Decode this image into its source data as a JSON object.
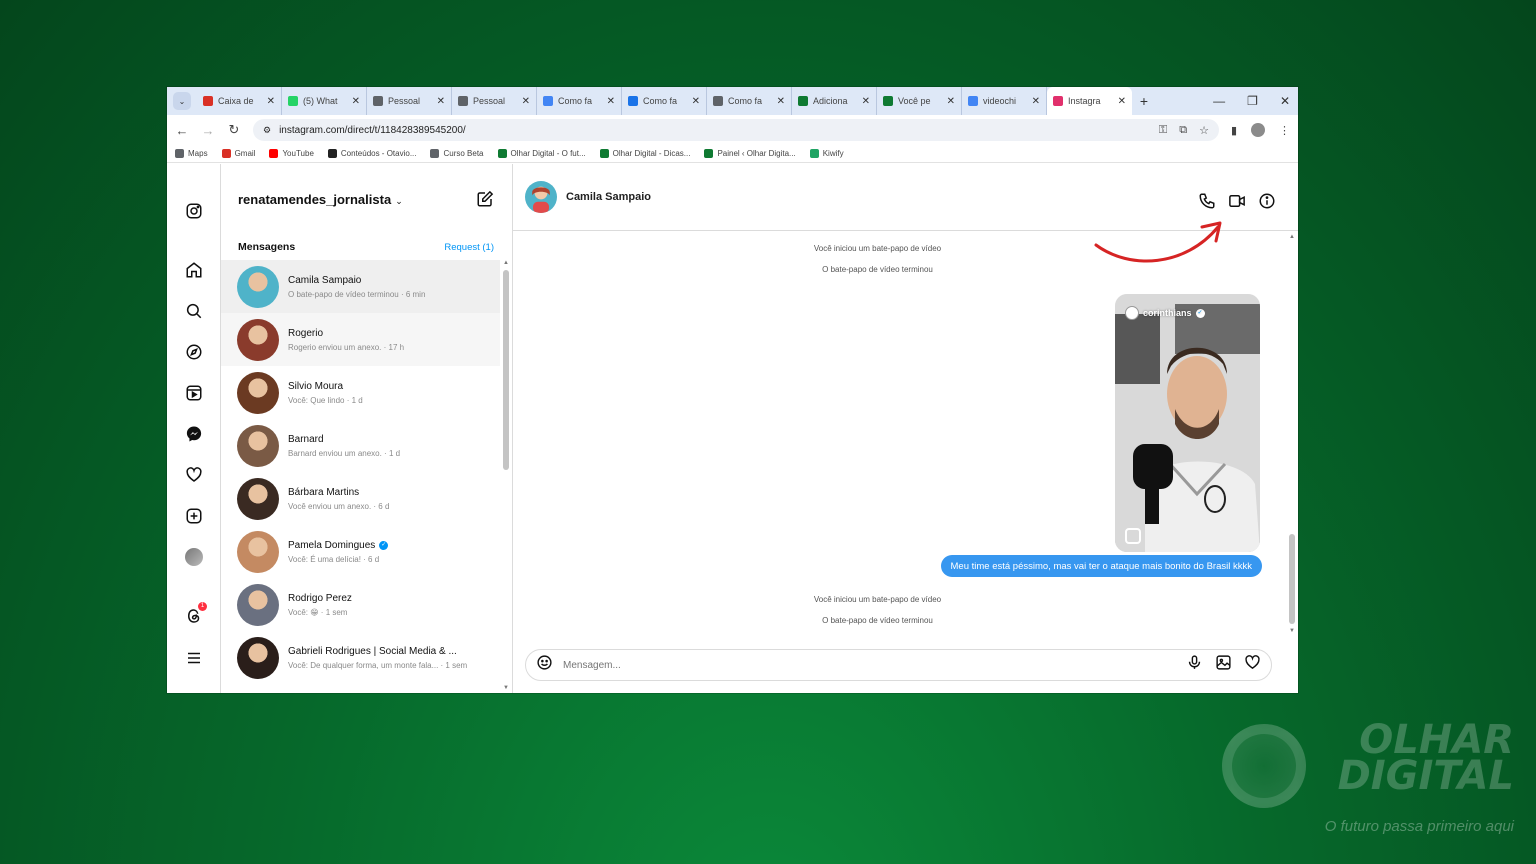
{
  "browser": {
    "tabs": [
      {
        "label": "Caixa de",
        "icon": "gmail-icon",
        "color": "#d93025"
      },
      {
        "label": "(5) What",
        "icon": "whatsapp-icon",
        "color": "#25d366"
      },
      {
        "label": "Pessoal",
        "icon": "web-icon",
        "color": "#5f6368"
      },
      {
        "label": "Pessoal",
        "icon": "web-icon",
        "color": "#5f6368"
      },
      {
        "label": "Como fa",
        "icon": "docs-icon",
        "color": "#4285f4"
      },
      {
        "label": "Como fa",
        "icon": "web-icon",
        "color": "#1a73e8"
      },
      {
        "label": "Como fa",
        "icon": "web-icon",
        "color": "#5f6368"
      },
      {
        "label": "Adiciona",
        "icon": "olhar-icon",
        "color": "#0f7a32"
      },
      {
        "label": "Você pe",
        "icon": "olhar-icon",
        "color": "#0f7a32"
      },
      {
        "label": "videochi",
        "icon": "google-icon",
        "color": "#4285f4"
      },
      {
        "label": "Instagra",
        "icon": "instagram-icon",
        "color": "#e1306c"
      }
    ],
    "url": "instagram.com/direct/t/118428389545200/",
    "bookmarks": [
      {
        "label": "Maps",
        "color": "#5f6368"
      },
      {
        "label": "Gmail",
        "color": "#d93025"
      },
      {
        "label": "YouTube",
        "color": "#ff0000"
      },
      {
        "label": "Conteúdos - Otavio...",
        "color": "#222222"
      },
      {
        "label": "Curso Beta",
        "color": "#5f6368"
      },
      {
        "label": "Olhar Digital - O fut...",
        "color": "#0f7a32"
      },
      {
        "label": "Olhar Digital - Dicas...",
        "color": "#0f7a32"
      },
      {
        "label": "Painel ‹ Olhar Digita...",
        "color": "#0f7a32"
      },
      {
        "label": "Kiwify",
        "color": "#1fa463"
      }
    ]
  },
  "instagram": {
    "username": "renatamendes_jornalista",
    "messages_label": "Mensagens",
    "request_label": "Request (1)",
    "notification_count": "1",
    "conversations": [
      {
        "name": "Camila Sampaio",
        "preview": "O bate-papo de vídeo terminou · 6 min",
        "verified": false,
        "color": "#4fb3c9"
      },
      {
        "name": "Rogerio",
        "preview": "Rogerio enviou um anexo. · 17 h",
        "verified": false,
        "color": "#8a3b2c"
      },
      {
        "name": "Silvio Moura",
        "preview": "Você: Que lindo · 1 d",
        "verified": false,
        "color": "#6b3a22"
      },
      {
        "name": "Barnard",
        "preview": "Barnard enviou um anexo. · 1 d",
        "verified": false,
        "color": "#7a5a45"
      },
      {
        "name": "Bárbara Martins",
        "preview": "Você enviou um anexo. · 6 d",
        "verified": false,
        "color": "#3a2a22"
      },
      {
        "name": "Pamela Domingues",
        "preview": "Você: É uma delícia! · 6 d",
        "verified": true,
        "color": "#c48a62"
      },
      {
        "name": "Rodrigo Perez",
        "preview": "Você: 😁 · 1 sem",
        "verified": false,
        "color": "#6a7080"
      },
      {
        "name": "Gabrieli Rodrigues | Social Media & ...",
        "preview": "Você: De qualquer forma, um monte fala... · 1 sem",
        "verified": false,
        "color": "#2a1e1a"
      }
    ],
    "chat": {
      "contact": "Camila Sampaio",
      "system_1": "Você iniciou um bate-papo de vídeo",
      "system_2": "O bate-papo de vídeo terminou",
      "system_3": "Você iniciou um bate-papo de vídeo",
      "system_4": "O bate-papo de vídeo terminou",
      "reel_account": "corinthians",
      "message": "Meu time está péssimo, mas vai ter o ataque mais bonito do Brasil kkkk",
      "composer_placeholder": "Mensagem..."
    }
  },
  "watermark": {
    "line1": "OLHAR",
    "line2": "DIGITAL",
    "tagline": "O futuro passa primeiro aqui"
  },
  "colors": {
    "accent": "#0095f6",
    "bubble": "#3797f0",
    "annotation": "#d62424"
  }
}
